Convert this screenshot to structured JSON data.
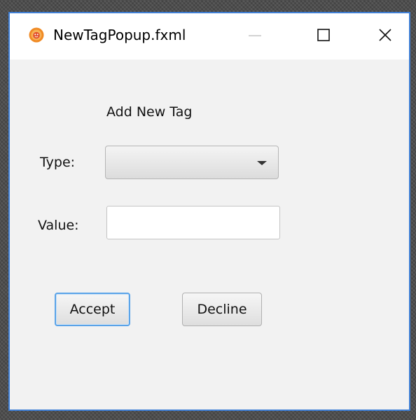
{
  "window": {
    "title": "NewTagPopup.fxml",
    "app_icon": "java-duke-icon",
    "controls": {
      "minimize_icon": "minimize-icon",
      "maximize_icon": "maximize-icon",
      "close_icon": "close-icon"
    },
    "accent_color": "#3f7fd6"
  },
  "form": {
    "heading": "Add New Tag",
    "type_label": "Type:",
    "type_selected": "",
    "value_label": "Value:",
    "value_text": ""
  },
  "buttons": {
    "accept_label": "Accept",
    "decline_label": "Decline"
  }
}
